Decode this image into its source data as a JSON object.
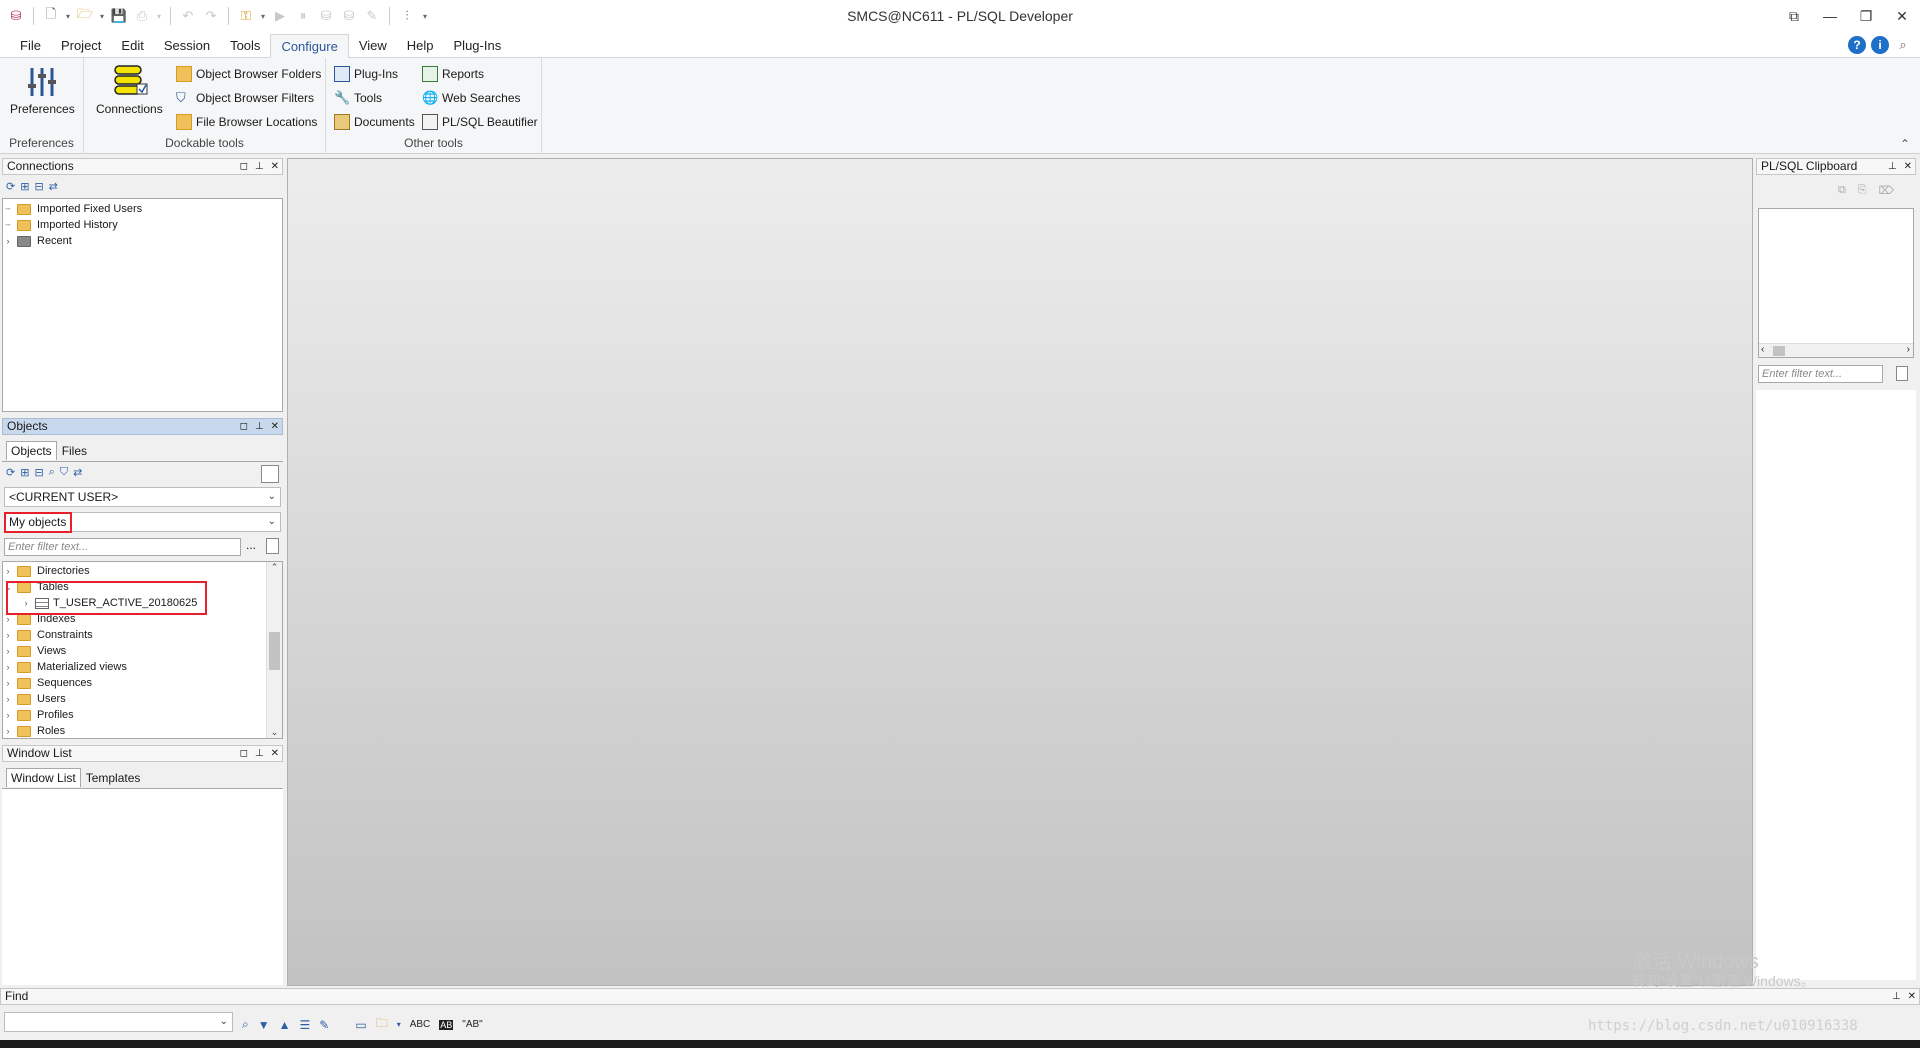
{
  "window": {
    "title": "SMCS@NC611 - PL/SQL Developer",
    "controls": {
      "restore": "⧉",
      "minimize": "—",
      "maximize": "❐",
      "close": "✕"
    }
  },
  "menu": {
    "tabs": [
      "File",
      "Project",
      "Edit",
      "Session",
      "Tools",
      "Configure",
      "View",
      "Help",
      "Plug-Ins"
    ],
    "active": "Configure"
  },
  "ribbon": {
    "preferences": {
      "button": "Preferences",
      "caption": "Preferences"
    },
    "dockable": {
      "connections": "Connections",
      "object_browser_folders": "Object Browser Folders",
      "object_browser_filters": "Object Browser Filters",
      "file_browser_locations": "File Browser Locations",
      "caption": "Dockable tools"
    },
    "other": {
      "plugins": "Plug-Ins",
      "tools": "Tools",
      "documents": "Documents",
      "reports": "Reports",
      "web_searches": "Web Searches",
      "beautifier": "PL/SQL Beautifier",
      "caption": "Other tools"
    }
  },
  "connections_panel": {
    "title": "Connections",
    "items": [
      "Imported Fixed Users",
      "Imported History",
      "Recent"
    ]
  },
  "objects_panel": {
    "title": "Objects",
    "tabs": [
      "Objects",
      "Files"
    ],
    "user_dropdown": "<CURRENT USER>",
    "filter_dropdown": "My objects",
    "filter_placeholder": "Enter filter text...",
    "ellipsis": "...",
    "tree": [
      {
        "label": "Directories",
        "expanded": false
      },
      {
        "label": "Tables",
        "expanded": true
      },
      {
        "label": "T_USER_ACTIVE_20180625",
        "child": true
      },
      {
        "label": "Indexes",
        "expanded": false
      },
      {
        "label": "Constraints",
        "expanded": false
      },
      {
        "label": "Views",
        "expanded": false
      },
      {
        "label": "Materialized views",
        "expanded": false
      },
      {
        "label": "Sequences",
        "expanded": false
      },
      {
        "label": "Users",
        "expanded": false
      },
      {
        "label": "Profiles",
        "expanded": false
      },
      {
        "label": "Roles",
        "expanded": false
      }
    ]
  },
  "window_list_panel": {
    "title": "Window List",
    "tabs": [
      "Window List",
      "Templates"
    ]
  },
  "clipboard_panel": {
    "title": "PL/SQL Clipboard",
    "filter_placeholder": "Enter filter text..."
  },
  "find_bar": {
    "title": "Find",
    "abc1": "ABC",
    "abc2": "AB",
    "abc3": "\"AB\""
  },
  "watermark": {
    "line1": "激活 Windows",
    "line2": "转到\"设置\"以激活 Windows。",
    "url": "https://blog.csdn.net/u010916338"
  },
  "colors": {
    "accent": "#2b579a",
    "highlight_box": "#e8202a",
    "folder": "#f0c05a"
  }
}
